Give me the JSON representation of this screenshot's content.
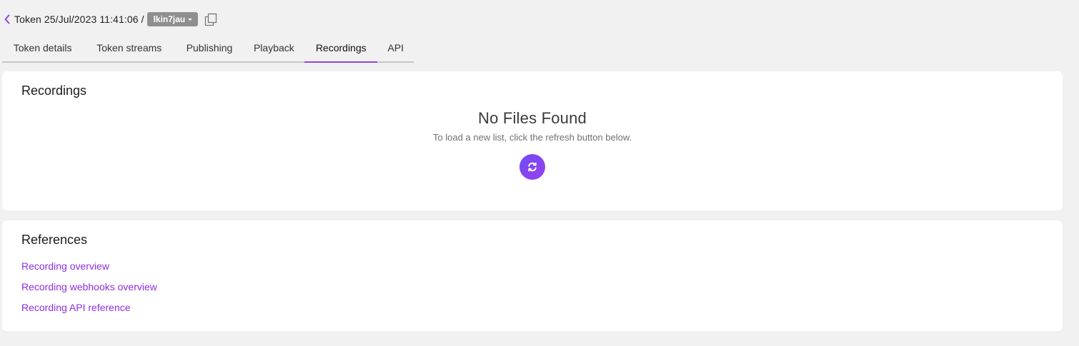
{
  "header": {
    "breadcrumb_text": "Token 25/Jul/2023 11:41:06 /",
    "token_badge": "lkin7jau",
    "back_icon": "chevron-left-icon",
    "copy_icon": "copy-icon"
  },
  "tabs": [
    {
      "label": "Token details",
      "active": false
    },
    {
      "label": "Token streams",
      "active": false
    },
    {
      "label": "Publishing",
      "active": false
    },
    {
      "label": "Playback",
      "active": false
    },
    {
      "label": "Recordings",
      "active": true
    },
    {
      "label": "API",
      "active": false
    }
  ],
  "recordings": {
    "title": "Recordings",
    "empty_title": "No Files Found",
    "empty_description": "To load a new list, click the refresh button below.",
    "refresh_icon": "refresh-icon"
  },
  "references": {
    "title": "References",
    "links": [
      {
        "label": "Recording overview"
      },
      {
        "label": "Recording webhooks overview"
      },
      {
        "label": "Recording API reference"
      }
    ]
  },
  "colors": {
    "accent": "#8e44e4",
    "link": "#8e2de2",
    "badge_bg": "#8f8f8f",
    "page_bg": "#f1f1f1"
  }
}
